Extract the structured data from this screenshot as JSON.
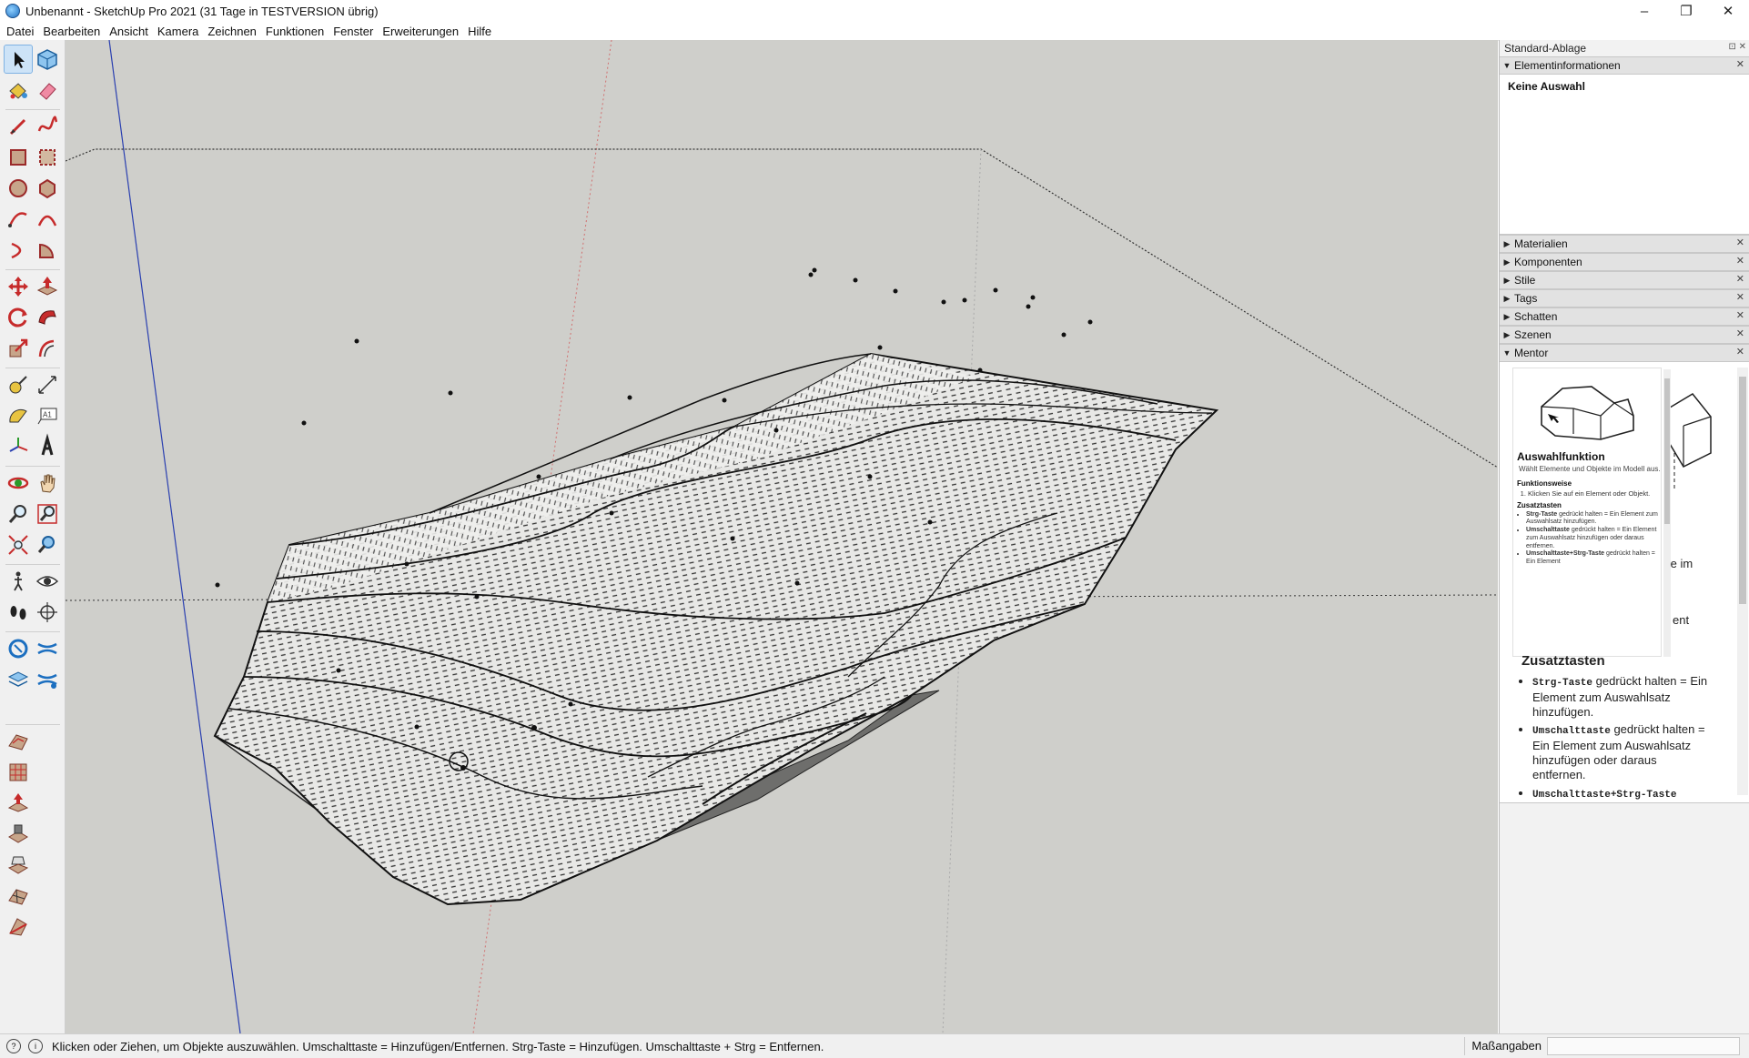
{
  "window": {
    "title": "Unbenannt - SketchUp Pro 2021 (31 Tage in TESTVERSION übrig)",
    "controls": {
      "minimize": "–",
      "restore": "❐",
      "close": "✕"
    }
  },
  "menu": [
    "Datei",
    "Bearbeiten",
    "Ansicht",
    "Kamera",
    "Zeichnen",
    "Funktionen",
    "Fenster",
    "Erweiterungen",
    "Hilfe"
  ],
  "toolbar_icons": [
    "select-icon",
    "component-icon",
    "paint-bucket-icon",
    "eraser-icon",
    "line-icon",
    "freehand-icon",
    "rectangle-icon",
    "rotated-rectangle-icon",
    "circle-icon",
    "polygon-icon",
    "arc-icon",
    "two-point-arc-icon",
    "three-point-arc-icon",
    "pie-icon",
    "move-icon",
    "push-pull-icon",
    "rotate-icon",
    "follow-me-icon",
    "scale-icon",
    "offset-icon",
    "tape-measure-icon",
    "dimension-icon",
    "protractor-icon",
    "text-icon",
    "axes-icon",
    "3d-text-icon",
    "orbit-icon",
    "pan-icon",
    "zoom-icon",
    "zoom-window-icon",
    "zoom-extents-icon",
    "previous-view-icon",
    "walk-icon",
    "look-around-icon",
    "footprints-icon",
    "position-camera-icon",
    "section-plane-icon",
    "section-display-icon",
    "sandbox-from-contours-icon",
    "sandbox-from-scratch-icon",
    "smoove-icon",
    "stamp-icon",
    "drape-icon",
    "add-detail-icon",
    "flip-edge-icon"
  ],
  "tray": {
    "title": "Standard-Ablage",
    "entity_info": {
      "header": "Elementinformationen",
      "content": "Keine Auswahl"
    },
    "panels": [
      "Materialien",
      "Komponenten",
      "Stile",
      "Tags",
      "Schatten",
      "Szenen"
    ],
    "mentor": {
      "header": "Mentor",
      "title": "Auswahlfunktion",
      "desc": "Wählt Elemente und Objekte im Modell aus.",
      "section1": "Funktionsweise",
      "step1": "Klicken Sie auf ein Element oder Objekt.",
      "section2": "Zusatztasten",
      "items": [
        {
          "key": "Strg-Taste",
          "text": "gedrückt halten = Ein Element zum Auswahlsatz hinzufügen."
        },
        {
          "key": "Umschalttaste",
          "text": "gedrückt halten = Ein Element zum Auswahlsatz hinzufügen oder daraus entfernen."
        },
        {
          "key": "Umschalttaste+Strg-Taste",
          "text": "gedrückt halten = Ein Element"
        }
      ],
      "behind_1": "te im",
      "behind_2": "ent"
    }
  },
  "status": {
    "text": "Klicken oder Ziehen, um Objekte auszuwählen. Umschalttaste = Hinzufügen/Entfernen. Strg-Taste = Hinzufügen. Umschalttaste + Strg = Entfernen.",
    "measure_label": "Maßangaben",
    "measure_value": ""
  },
  "colors": {
    "viewport_bg": "#cfcfcb",
    "axis_blue": "#2a3fb0",
    "axis_red": "#d07070",
    "accent": "#cde3f7"
  }
}
